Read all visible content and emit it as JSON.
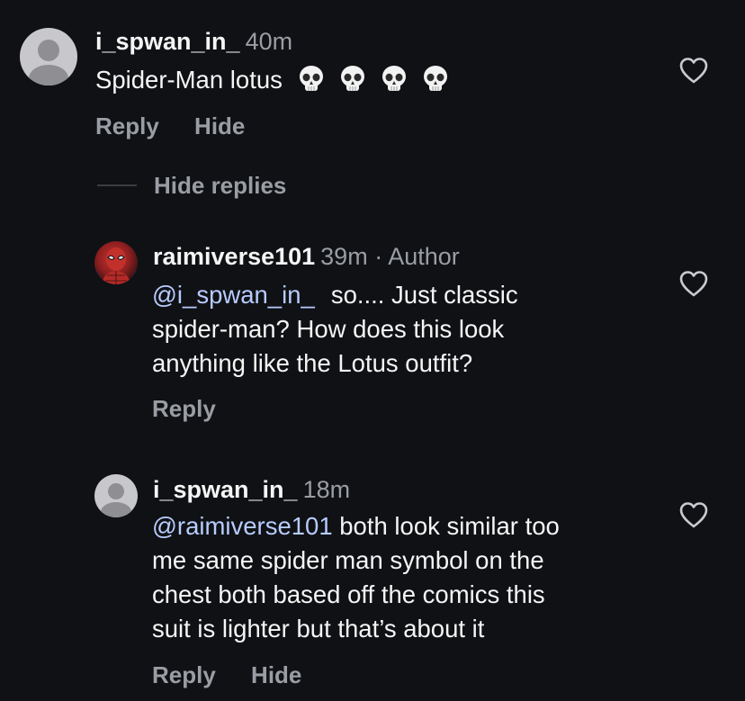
{
  "comments": [
    {
      "username": "i_spwan_in_",
      "time": "40m",
      "text": "Spider-Man lotus",
      "emoji_icons": [
        "skull-emoji-icon",
        "skull-emoji-icon",
        "skull-emoji-icon",
        "skull-emoji-icon"
      ],
      "reply_label": "Reply",
      "hide_label": "Hide"
    },
    {
      "username": "raimiverse101",
      "time": "39m",
      "author_badge": "· Author",
      "mention": "@i_spwan_in_",
      "text_lines": [
        "so.... Just classic",
        "spider-man? How does this look",
        "anything like the Lotus outfit?"
      ],
      "reply_label": "Reply"
    },
    {
      "username": "i_spwan_in_",
      "time": "18m",
      "mention": "@raimiverse101",
      "text_lines": [
        " both look similar too",
        "me same spider man symbol on the",
        "chest both based off the comics this",
        "suit is lighter but that’s about it"
      ],
      "reply_label": "Reply",
      "hide_label": "Hide"
    }
  ],
  "thread": {
    "hide_replies_label": "Hide replies"
  },
  "icons": {
    "like": "heart-outline-icon",
    "avatar_default": "default-avatar-icon",
    "emoji": "skull-emoji-icon"
  },
  "colors": {
    "background": "#0f1114",
    "text": "#f5f5f5",
    "secondary": "#9a9da3",
    "mention": "#b7cbff"
  }
}
